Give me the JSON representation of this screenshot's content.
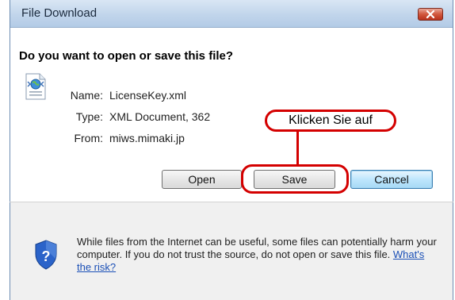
{
  "dialog": {
    "title": "File Download",
    "question": "Do you want to open or save this file?",
    "icons": {
      "close": "close-x-icon",
      "file": "xml-file-icon",
      "shield": "shield-question-icon"
    }
  },
  "file_info": {
    "name_label": "Name:",
    "name_value": "LicenseKey.xml",
    "type_label": "Type:",
    "type_value": "XML Document, 362",
    "from_label": "From:",
    "from_value": "miws.mimaki.jp"
  },
  "buttons": {
    "open_label": "Open",
    "save_label": "Save",
    "cancel_label": "Cancel"
  },
  "annotation": {
    "callout_text": "Klicken Sie auf",
    "color": "#d40000"
  },
  "footer": {
    "warning_text": "While files from the Internet can be useful, some files can potentially harm your computer. If you do not trust the source, do not open or save this file.",
    "risk_link": "What's the risk?"
  }
}
